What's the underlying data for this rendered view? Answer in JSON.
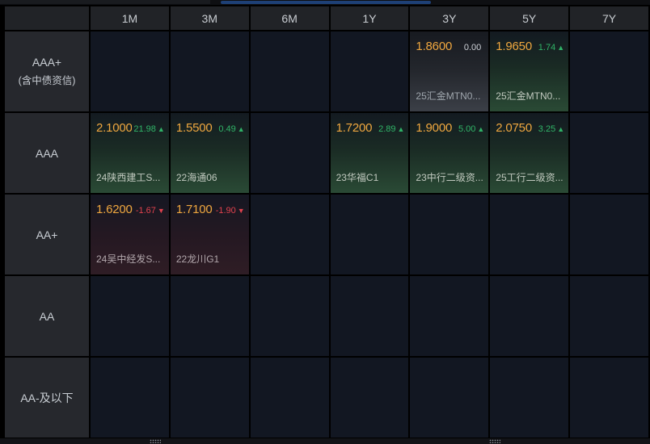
{
  "colors": {
    "yield_orange": "#efa73f",
    "up_green": "#30b468",
    "down_red": "#e2424e",
    "flat_text": "#ced2d8",
    "header_bg": "#212327",
    "cell_bg": "#121722",
    "scroll_thumb_blue": "#1e4076"
  },
  "icons": {
    "up": "▲",
    "down": "▼"
  },
  "header": {
    "columns": [
      "1M",
      "3M",
      "6M",
      "1Y",
      "3Y",
      "5Y",
      "7Y"
    ]
  },
  "rows": [
    {
      "label": "AAA+",
      "sublabel": "(含中债资信)",
      "cells": [
        null,
        null,
        null,
        null,
        {
          "yield": "1.8600",
          "change": "0.00",
          "dir": "flat",
          "bond": "25汇金MTN0..."
        },
        {
          "yield": "1.9650",
          "change": "1.74",
          "dir": "up",
          "bond": "25汇金MTN0..."
        },
        null
      ]
    },
    {
      "label": "AAA",
      "cells": [
        {
          "yield": "2.1000",
          "change": "21.98",
          "dir": "up",
          "bond": "24陕西建工S..."
        },
        {
          "yield": "1.5500",
          "change": "0.49",
          "dir": "up",
          "bond": "22海通06"
        },
        null,
        {
          "yield": "1.7200",
          "change": "2.89",
          "dir": "up",
          "bond": "23华福C1"
        },
        {
          "yield": "1.9000",
          "change": "5.00",
          "dir": "up",
          "bond": "23中行二级资..."
        },
        {
          "yield": "2.0750",
          "change": "3.25",
          "dir": "up",
          "bond": "25工行二级资..."
        },
        null
      ]
    },
    {
      "label": "AA+",
      "cells": [
        {
          "yield": "1.6200",
          "change": "-1.67",
          "dir": "down",
          "bond": "24吴中经发S..."
        },
        {
          "yield": "1.7100",
          "change": "-1.90",
          "dir": "down",
          "bond": "22龙川G1"
        },
        null,
        null,
        null,
        null,
        null
      ]
    },
    {
      "label": "AA",
      "cells": [
        null,
        null,
        null,
        null,
        null,
        null,
        null
      ]
    },
    {
      "label": "AA-及以下",
      "cells": [
        null,
        null,
        null,
        null,
        null,
        null,
        null
      ]
    }
  ]
}
